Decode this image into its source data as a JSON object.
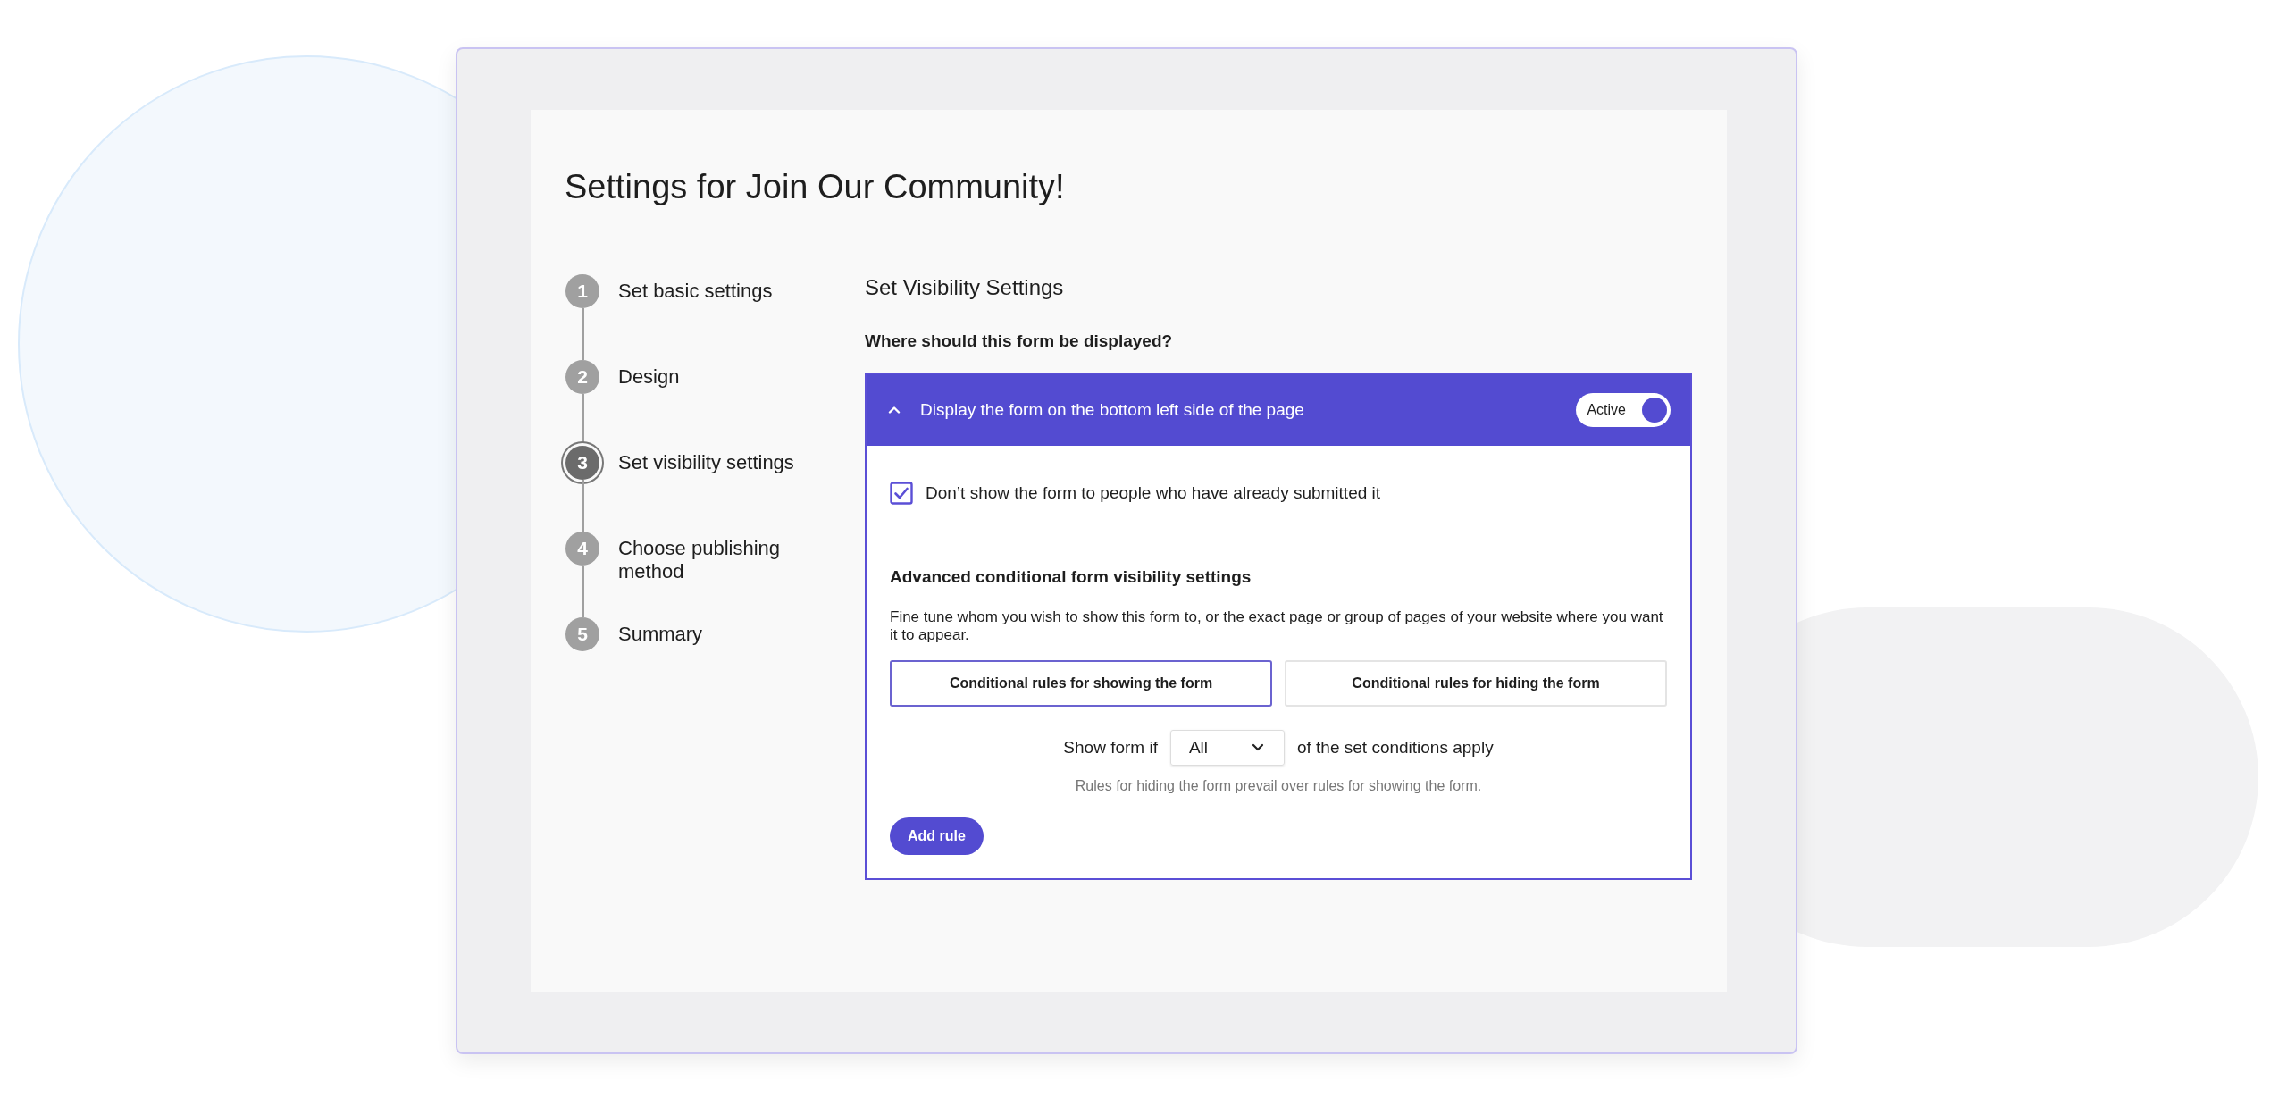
{
  "title": "Settings for Join Our Community!",
  "steps": [
    {
      "number": "1",
      "label": "Set basic settings",
      "selected": false
    },
    {
      "number": "2",
      "label": "Design",
      "selected": false
    },
    {
      "number": "3",
      "label": "Set visibility settings",
      "selected": true
    },
    {
      "number": "4",
      "label": "Choose publishing method",
      "selected": false
    },
    {
      "number": "5",
      "label": "Summary",
      "selected": false
    }
  ],
  "section_title": "Set Visibility Settings",
  "question": "Where should this form be displayed?",
  "panel": {
    "title": "Display the form on the bottom left side of the page",
    "expanded": true,
    "toggle": {
      "label": "Active",
      "on": true
    }
  },
  "checkbox": {
    "label": "Don’t show the form to people who have already submitted it",
    "checked": true
  },
  "advanced": {
    "heading": "Advanced conditional form visibility settings",
    "description": "Fine tune whom you wish to show this form to, or the exact page or group of pages of your website where you want it to appear."
  },
  "rule_tabs": [
    {
      "label": "Conditional rules for showing the form",
      "selected": true
    },
    {
      "label": "Conditional rules for hiding the form",
      "selected": false
    }
  ],
  "condition": {
    "prefix": "Show form if",
    "select": "All",
    "suffix": "of the set conditions apply"
  },
  "hint": "Rules for hiding the form prevail over rules for showing the form.",
  "add_button": "Add rule"
}
